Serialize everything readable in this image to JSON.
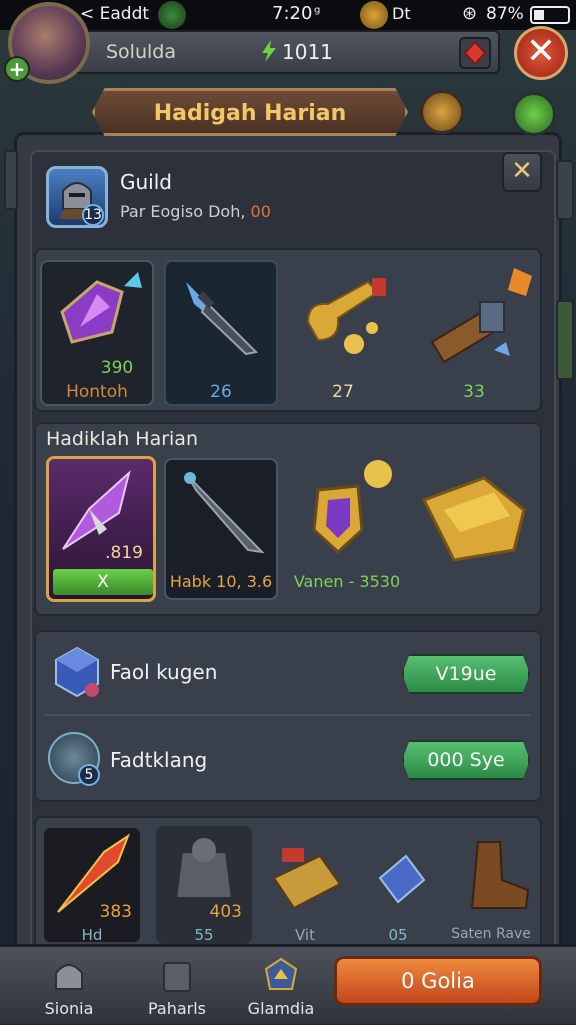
{
  "status_bar": {
    "carrier": "< Eaddt",
    "time": "7:20",
    "time_suffix": "ᵍ",
    "center": "Dt",
    "battery": "87%"
  },
  "top_bar": {
    "player_name": "Solulda",
    "gems": "1011"
  },
  "banner": {
    "title": "Hadigah Harian"
  },
  "guild": {
    "title": "Guild",
    "subtitle": "Par Eogiso Doh, ",
    "subtitle_value": "00",
    "level": "13"
  },
  "reward_row_1": [
    {
      "icon": "purple-crystal-icon",
      "value": "390",
      "label": "Hontoh",
      "value_color": "#7fd15a",
      "label_color": "#d48a3a"
    },
    {
      "icon": "dagger-icon",
      "value": "26",
      "value_color": "#6aa8e8"
    },
    {
      "icon": "gold-key-icon",
      "value": "27",
      "value_color": "#e8d9a6"
    },
    {
      "icon": "cannon-icon",
      "value": "33",
      "value_color": "#7fd15a"
    }
  ],
  "daily_section": {
    "title": "Hadiklah Harian",
    "items": [
      {
        "icon": "amethyst-sword-icon",
        "value": ".819",
        "button": "X"
      },
      {
        "icon": "dark-blade-icon",
        "label": "Habk 10, 3.6"
      },
      {
        "icon": "shield-icon",
        "label": "Vanen - 3530"
      },
      {
        "icon": "gold-chest-icon"
      }
    ]
  },
  "tasks": [
    {
      "icon": "cube-icon",
      "label": "Faol kugen",
      "button": "V19ue"
    },
    {
      "icon": "hero-icon",
      "label": "Fadtklang",
      "button": "000 Sye",
      "level": "5"
    }
  ],
  "inventory": [
    {
      "icon": "fire-arrow-icon",
      "value": "383",
      "label": "Hd"
    },
    {
      "icon": "armor-icon",
      "value": "403",
      "label": "55"
    },
    {
      "icon": "scroll-icon",
      "label": "Vit"
    },
    {
      "icon": "blue-rune-icon",
      "label": "05"
    },
    {
      "icon": "boot-icon",
      "label": "Saten Rave"
    }
  ],
  "nav": [
    {
      "icon": "helmet-icon",
      "label": "Sionia"
    },
    {
      "icon": "scroll-box-icon",
      "label": "Paharls"
    },
    {
      "icon": "crest-icon",
      "label": "Glamdia"
    }
  ],
  "action_button": "0 Golia",
  "colors": {
    "accent_gold": "#f3c766",
    "green_button": "#3aa85a",
    "orange_button": "#e06a2c"
  }
}
